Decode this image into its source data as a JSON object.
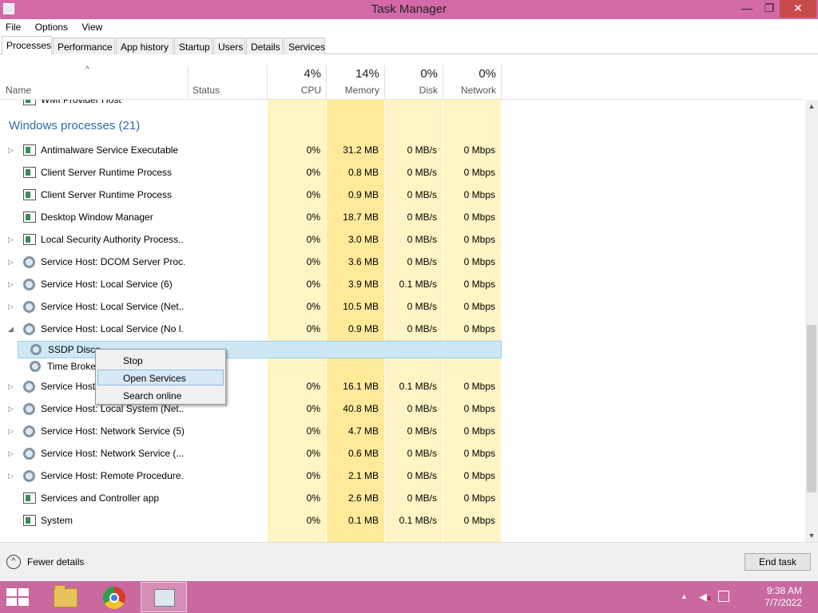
{
  "window": {
    "title": "Task Manager",
    "minimize": "—",
    "restore": "❐",
    "close": "✕"
  },
  "menu": [
    "File",
    "Options",
    "View"
  ],
  "tabs": [
    "Processes",
    "Performance",
    "App history",
    "Startup",
    "Users",
    "Details",
    "Services"
  ],
  "active_tab": "Processes",
  "columns": {
    "name": "Name",
    "status": "Status",
    "cpu": {
      "pct": "4%",
      "label": "CPU"
    },
    "memory": {
      "pct": "14%",
      "label": "Memory"
    },
    "disk": {
      "pct": "0%",
      "label": "Disk"
    },
    "network": {
      "pct": "0%",
      "label": "Network"
    }
  },
  "group_title": "Windows processes (21)",
  "partial_top": {
    "name": "WMI Provider Host"
  },
  "processes": [
    {
      "name": "Antimalware Service Executable",
      "cpu": "0%",
      "memory": "31.2 MB",
      "disk": "0 MB/s",
      "network": "0 Mbps",
      "icon": "window-icon",
      "expand": "▷"
    },
    {
      "name": "Client Server Runtime Process",
      "cpu": "0%",
      "memory": "0.8 MB",
      "disk": "0 MB/s",
      "network": "0 Mbps",
      "icon": "window-icon",
      "expand": ""
    },
    {
      "name": "Client Server Runtime Process",
      "cpu": "0%",
      "memory": "0.9 MB",
      "disk": "0 MB/s",
      "network": "0 Mbps",
      "icon": "window-icon",
      "expand": ""
    },
    {
      "name": "Desktop Window Manager",
      "cpu": "0%",
      "memory": "18.7 MB",
      "disk": "0 MB/s",
      "network": "0 Mbps",
      "icon": "window-icon",
      "expand": ""
    },
    {
      "name": "Local Security Authority Process...",
      "cpu": "0%",
      "memory": "3.0 MB",
      "disk": "0 MB/s",
      "network": "0 Mbps",
      "icon": "window-icon",
      "expand": "▷"
    },
    {
      "name": "Service Host: DCOM Server Proc...",
      "cpu": "0%",
      "memory": "3.6 MB",
      "disk": "0 MB/s",
      "network": "0 Mbps",
      "icon": "gear-icon",
      "expand": "▷"
    },
    {
      "name": "Service Host: Local Service (6)",
      "cpu": "0%",
      "memory": "3.9 MB",
      "disk": "0.1 MB/s",
      "network": "0 Mbps",
      "icon": "gear-icon",
      "expand": "▷"
    },
    {
      "name": "Service Host: Local Service (Net...",
      "cpu": "0%",
      "memory": "10.5 MB",
      "disk": "0 MB/s",
      "network": "0 Mbps",
      "icon": "gear-icon",
      "expand": "▷"
    },
    {
      "name": "Service Host: Local Service (No l...",
      "cpu": "0%",
      "memory": "0.9 MB",
      "disk": "0 MB/s",
      "network": "0 Mbps",
      "icon": "gear-icon",
      "expand": "◢"
    }
  ],
  "children": [
    {
      "name": "SSDP Disco",
      "selected": true
    },
    {
      "name": "Time Broke",
      "selected": false
    }
  ],
  "processes_after": [
    {
      "name": "Service Host:",
      "cpu": "0%",
      "memory": "16.1 MB",
      "disk": "0.1 MB/s",
      "network": "0 Mbps",
      "icon": "gear-icon",
      "expand": "▷"
    },
    {
      "name": "Service Host: Local System (Net...",
      "cpu": "0%",
      "memory": "40.8 MB",
      "disk": "0 MB/s",
      "network": "0 Mbps",
      "icon": "gear-icon",
      "expand": "▷"
    },
    {
      "name": "Service Host: Network Service (5)",
      "cpu": "0%",
      "memory": "4.7 MB",
      "disk": "0 MB/s",
      "network": "0 Mbps",
      "icon": "gear-icon",
      "expand": "▷"
    },
    {
      "name": "Service Host: Network Service (...",
      "cpu": "0%",
      "memory": "0.6 MB",
      "disk": "0 MB/s",
      "network": "0 Mbps",
      "icon": "gear-icon",
      "expand": "▷"
    },
    {
      "name": "Service Host: Remote Procedure...",
      "cpu": "0%",
      "memory": "2.1 MB",
      "disk": "0 MB/s",
      "network": "0 Mbps",
      "icon": "gear-icon",
      "expand": "▷"
    },
    {
      "name": "Services and Controller app",
      "cpu": "0%",
      "memory": "2.6 MB",
      "disk": "0 MB/s",
      "network": "0 Mbps",
      "icon": "window-icon",
      "expand": ""
    },
    {
      "name": "System",
      "cpu": "0%",
      "memory": "0.1 MB",
      "disk": "0.1 MB/s",
      "network": "0 Mbps",
      "icon": "window-icon",
      "expand": ""
    }
  ],
  "context_menu": {
    "items": [
      "Stop",
      "Open Services",
      "Search online"
    ],
    "highlighted": "Open Services"
  },
  "footer": {
    "fewer_details": "Fewer details",
    "end_task": "End task"
  },
  "taskbar": {
    "time": "9:38 AM",
    "date": "7/7/2022"
  },
  "colors": {
    "titlebar": "#d469a8",
    "taskbar": "#c9699f",
    "heat_light": "#fff4c4",
    "heat_dark": "#ffe99a",
    "group_title": "#2a6cae",
    "selection": "#cde8f4"
  }
}
